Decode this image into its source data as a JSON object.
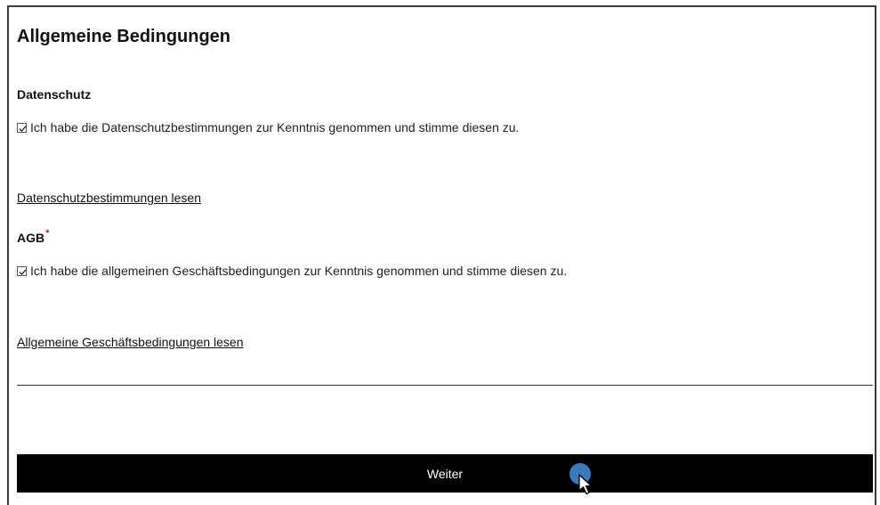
{
  "page": {
    "title": "Allgemeine Bedingungen"
  },
  "privacy": {
    "heading": "Datenschutz",
    "checkbox_label": "Ich habe die Datenschutzbestimmungen zur Kenntnis genommen und stimme diesen zu.",
    "checked": true,
    "link_text": "Datenschutzbestimmungen lesen"
  },
  "terms": {
    "heading": "AGB",
    "required_marker": "*",
    "checkbox_label": "Ich habe die allgemeinen Geschäftsbedingungen zur Kenntnis genommen und stimme diesen zu.",
    "checked": true,
    "link_text": "Allgemeine Geschäftsbedingungen lesen"
  },
  "actions": {
    "next_label": "Weiter"
  },
  "colors": {
    "button_bg": "#000000",
    "button_text": "#ffffff",
    "required": "#e0141e",
    "cursor_dot": "#3b82c8"
  }
}
